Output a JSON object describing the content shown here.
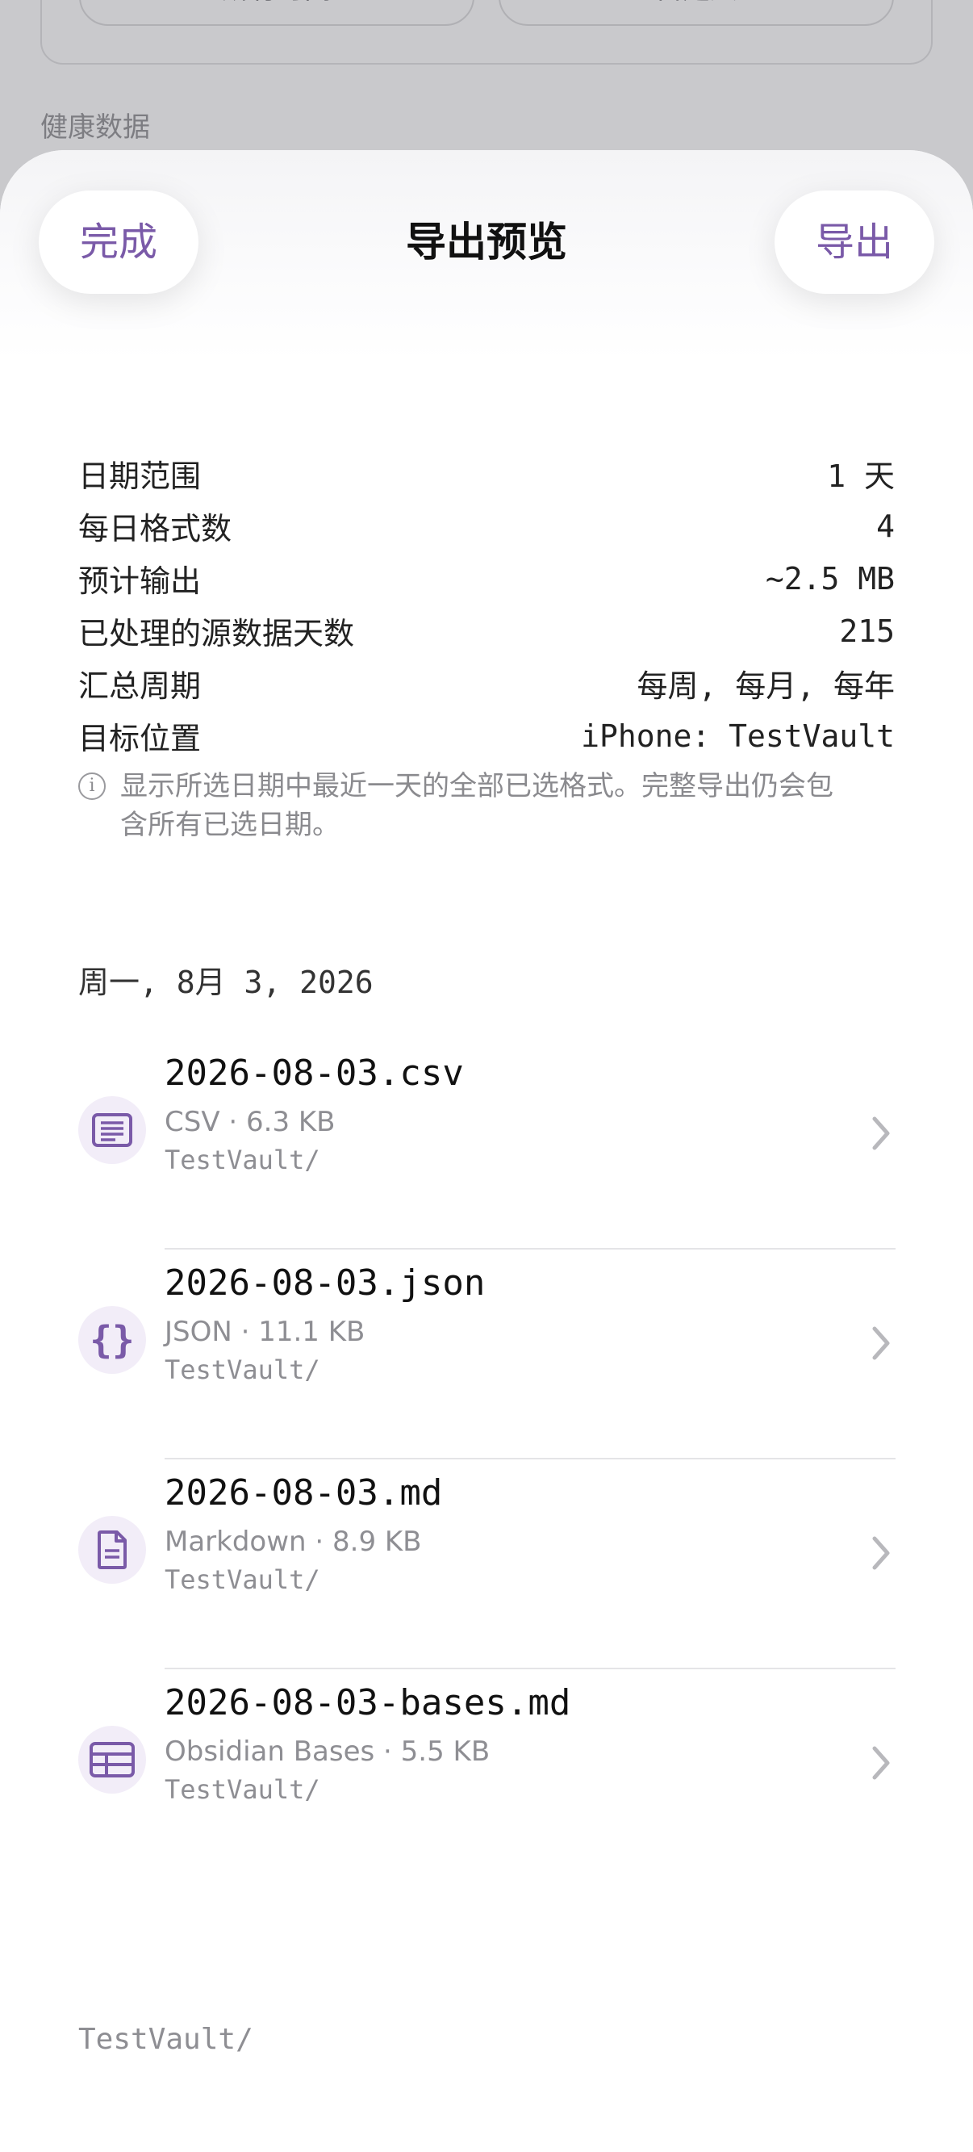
{
  "background": {
    "pill_left": "所有时间",
    "pill_right": "自定义",
    "section_title": "健康数据"
  },
  "sheet": {
    "done_label": "完成",
    "title": "导出预览",
    "export_label": "导出"
  },
  "summary": [
    {
      "label": "日期范围",
      "value": "1 天"
    },
    {
      "label": "每日格式数",
      "value": "4"
    },
    {
      "label": "预计输出",
      "value": "~2.5 MB"
    },
    {
      "label": "已处理的源数据天数",
      "value": "215"
    },
    {
      "label": "汇总周期",
      "value": "每周, 每月, 每年"
    },
    {
      "label": "目标位置",
      "value": "iPhone: TestVault"
    }
  ],
  "note": "显示所选日期中最近一天的全部已选格式。完整导出仍会包含所有已选日期。",
  "date_header": "周一, 8月 3, 2026",
  "files": [
    {
      "name": "2026-08-03.csv",
      "meta": "CSV · 6.3 KB",
      "path": "TestVault/",
      "icon": "list-document-icon"
    },
    {
      "name": "2026-08-03.json",
      "meta": "JSON · 11.1 KB",
      "path": "TestVault/",
      "icon": "curly-braces-icon"
    },
    {
      "name": "2026-08-03.md",
      "meta": "Markdown · 8.9 KB",
      "path": "TestVault/",
      "icon": "document-text-icon"
    },
    {
      "name": "2026-08-03-bases.md",
      "meta": "Obsidian Bases · 5.5 KB",
      "path": "TestVault/",
      "icon": "table-icon"
    }
  ],
  "footer_path": "TestVault/",
  "colors": {
    "accent": "#7a5aa8",
    "icon_bg": "#f2edf8"
  }
}
